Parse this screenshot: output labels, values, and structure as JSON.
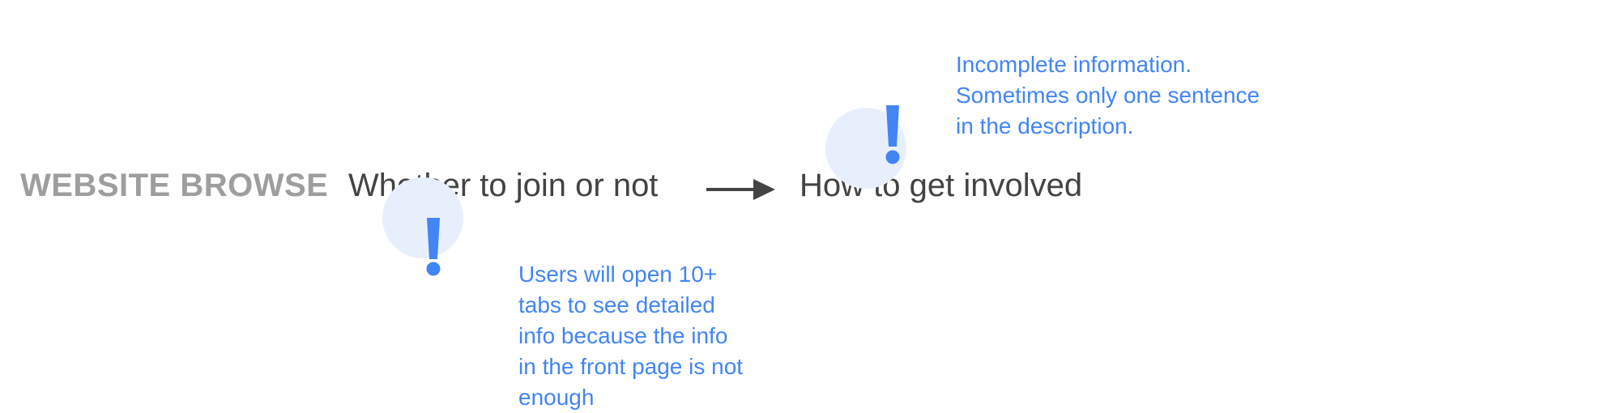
{
  "section_label": "WEBSITE BROWSE",
  "steps": [
    {
      "label": "Whether to join or not"
    },
    {
      "label": "How to get involved"
    }
  ],
  "colors": {
    "label_gray": "#9e9e9e",
    "step_text": "#434343",
    "accent_blue": "#4285f4",
    "marker_circle": "#e8effc",
    "arrow": "#444444"
  },
  "pain_points": [
    {
      "icon": "exclamation-icon",
      "lines": [
        "Users will open 10+",
        "tabs to see detailed",
        "info because the info",
        "in the front page is not",
        "enough"
      ]
    },
    {
      "icon": "exclamation-icon",
      "lines": [
        "Incomplete information.",
        "Sometimes only one sentence",
        "in the description."
      ]
    }
  ]
}
